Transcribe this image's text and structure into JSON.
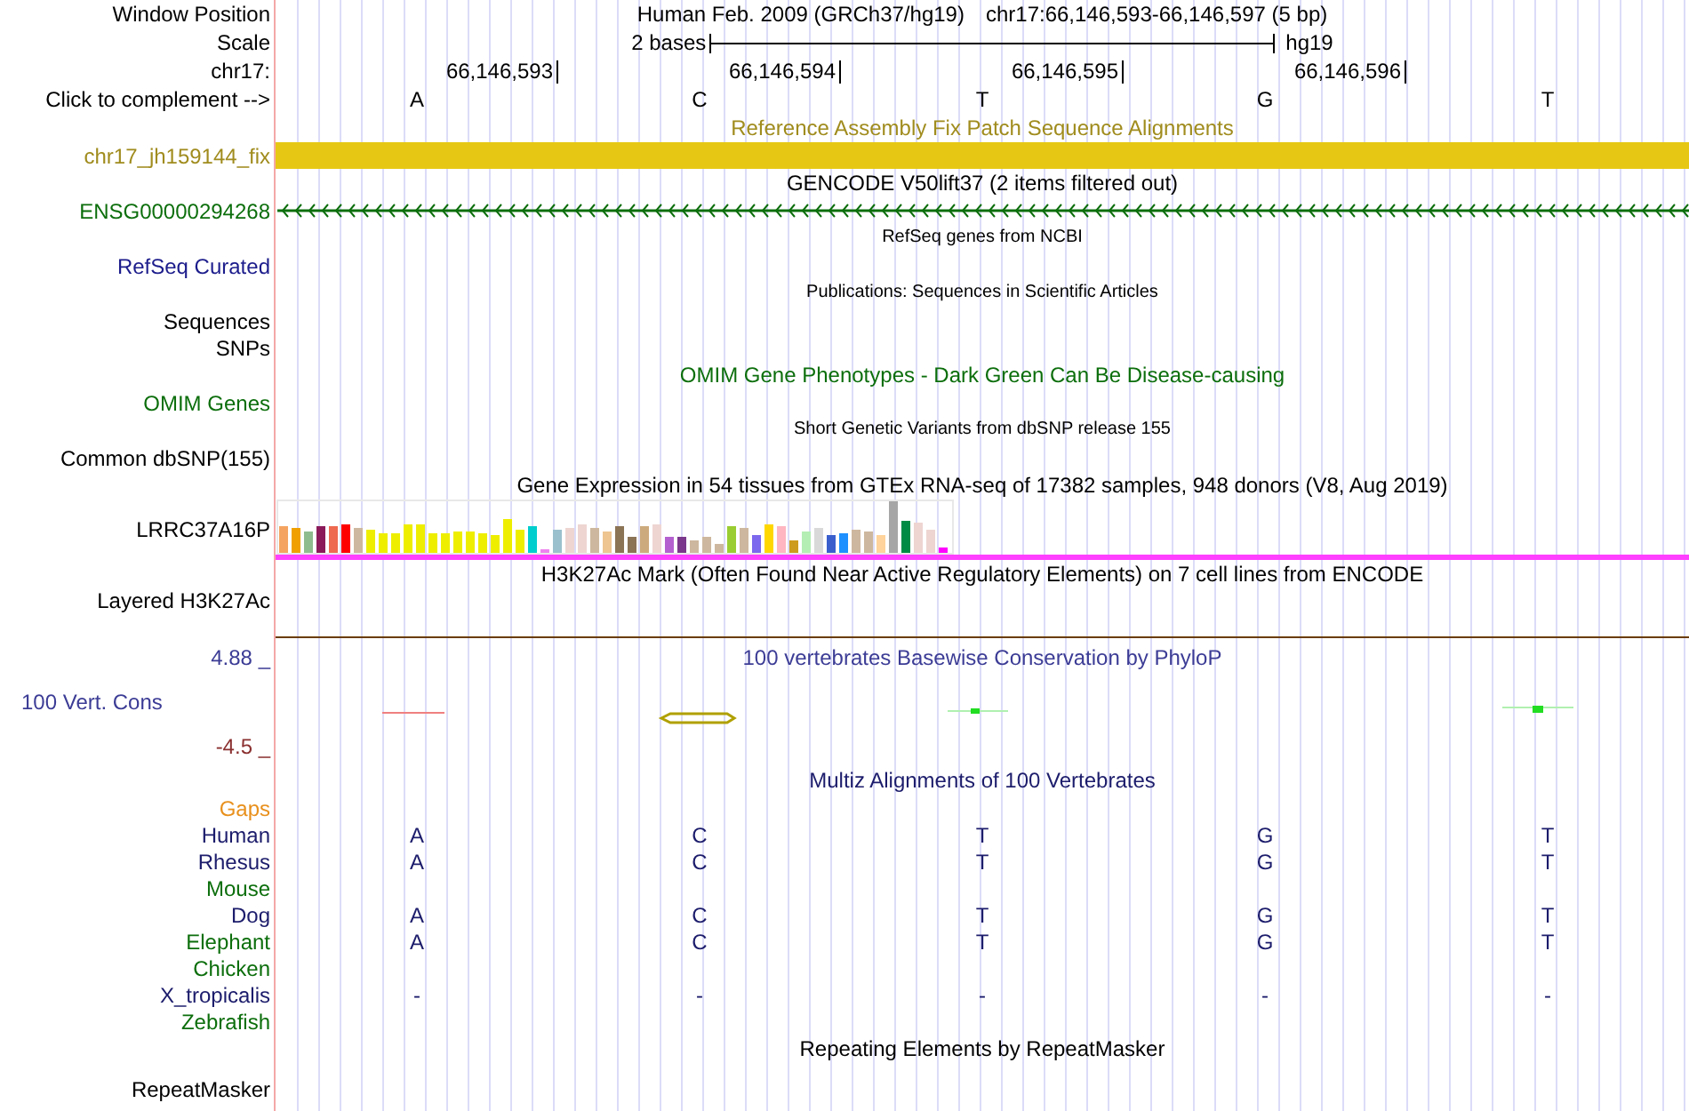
{
  "header": {
    "label": "Window Position",
    "assembly": "Human Feb. 2009 (GRCh37/hg19)",
    "position": "chr17:66,146,593-66,146,597 (5 bp)"
  },
  "scale": {
    "label": "Scale",
    "span": "2 bases",
    "db": "hg19"
  },
  "coordinates": {
    "label": "chr17:",
    "ticks": [
      "66,146,593",
      "66,146,594",
      "66,146,595",
      "66,146,596"
    ]
  },
  "complement": {
    "label": "Click to complement -->",
    "bases": [
      "A",
      "C",
      "T",
      "G",
      "T"
    ]
  },
  "rows": [
    {
      "kind": "title",
      "text": "Reference Assembly Fix Patch Sequence Alignments",
      "color": "#a08c1e"
    },
    {
      "kind": "feature-bar",
      "label": "chr17_jh159144_fix",
      "color": "#a08c1e"
    },
    {
      "kind": "title",
      "text": "GENCODE V50lift37 (2 items filtered out)",
      "color": "#000000"
    },
    {
      "kind": "gene",
      "label": "ENSG00000294268",
      "color": "#0c6e0c"
    },
    {
      "kind": "minor-title",
      "text": "RefSeq genes from NCBI",
      "color": "#000000"
    },
    {
      "kind": "label",
      "label": "RefSeq Curated",
      "color": "#1c1c8c"
    },
    {
      "kind": "minor-title",
      "text": "Publications: Sequences in Scientific Articles",
      "color": "#000000"
    },
    {
      "kind": "label",
      "label": "Sequences",
      "color": "#000000"
    },
    {
      "kind": "label",
      "label": "SNPs",
      "color": "#000000"
    },
    {
      "kind": "title",
      "text": "OMIM Gene Phenotypes - Dark Green Can Be Disease-causing",
      "color": "#0c6e0c"
    },
    {
      "kind": "label",
      "label": "OMIM Genes",
      "color": "#0c6e0c"
    },
    {
      "kind": "minor-title",
      "text": "Short Genetic Variants from dbSNP release 155",
      "color": "#000000"
    },
    {
      "kind": "label",
      "label": "Common dbSNP(155)",
      "color": "#000000"
    },
    {
      "kind": "title",
      "text": "Gene Expression in 54 tissues from GTEx RNA-seq of 17382 samples, 948 donors (V8, Aug 2019)",
      "color": "#000000"
    },
    {
      "kind": "expression",
      "label": "LRRC37A16P",
      "color": "#000000"
    },
    {
      "kind": "title",
      "text": "H3K27Ac Mark (Often Found Near Active Regulatory Elements) on 7 cell lines from ENCODE",
      "color": "#000000"
    },
    {
      "kind": "layered",
      "label": "Layered H3K27Ac",
      "color": "#000000"
    },
    {
      "kind": "wiggle",
      "label": "100 Vert. Cons",
      "color": "#3c3c96",
      "max": "4.88 _",
      "min": "-4.5 _",
      "title": "100 vertebrates Basewise Conservation by PhyloP"
    },
    {
      "kind": "title",
      "text": "Multiz Alignments of 100 Vertebrates",
      "color": "#1c1c6c"
    },
    {
      "kind": "label",
      "label": "Gaps",
      "color": "#e8901c"
    },
    {
      "kind": "alignment",
      "label": "Human",
      "color": "#1c1c6c",
      "bases": [
        "A",
        "C",
        "T",
        "G",
        "T"
      ]
    },
    {
      "kind": "alignment",
      "label": "Rhesus",
      "color": "#1c1c6c",
      "bases": [
        "A",
        "C",
        "T",
        "G",
        "T"
      ]
    },
    {
      "kind": "alignment",
      "label": "Mouse",
      "color": "#0c6e0c"
    },
    {
      "kind": "alignment",
      "label": "Dog",
      "color": "#1c1c6c",
      "bases": [
        "A",
        "C",
        "T",
        "G",
        "T"
      ]
    },
    {
      "kind": "alignment",
      "label": "Elephant",
      "color": "#0c6e0c",
      "bases": [
        "A",
        "C",
        "T",
        "G",
        "T"
      ]
    },
    {
      "kind": "alignment",
      "label": "Chicken",
      "color": "#0c6e0c"
    },
    {
      "kind": "alignment",
      "label": "X_tropicalis",
      "color": "#1c1c6c",
      "bases": [
        "-",
        "-",
        "-",
        "-",
        "-"
      ]
    },
    {
      "kind": "alignment",
      "label": "Zebrafish",
      "color": "#0c6e0c"
    },
    {
      "kind": "title",
      "text": "Repeating Elements by RepeatMasker",
      "color": "#000000"
    },
    {
      "kind": "last-label",
      "label": "RepeatMasker",
      "color": "#000000"
    }
  ]
}
